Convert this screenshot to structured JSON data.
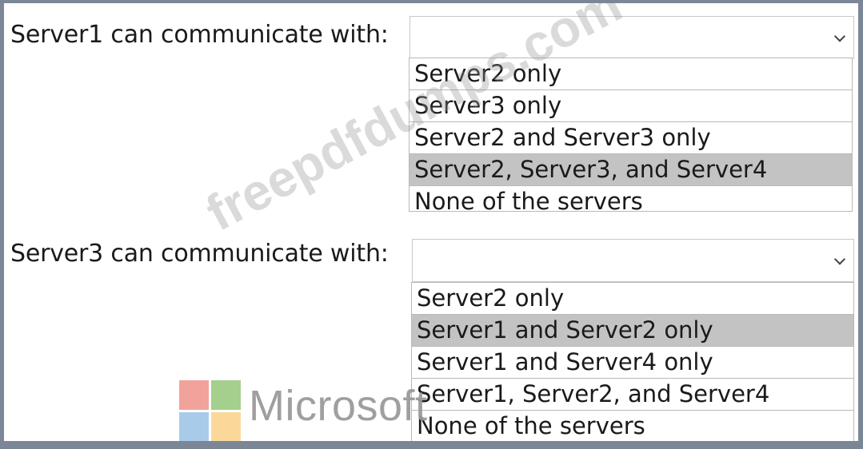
{
  "questions": [
    {
      "label": "Server1 can communicate with:",
      "selected_value": "",
      "options": [
        "Server2 only",
        "Server3 only",
        "Server2 and Server3 only",
        "Server2, Server3, and Server4",
        "None of the servers"
      ],
      "highlighted_index": 3
    },
    {
      "label": "Server3 can communicate with:",
      "selected_value": "",
      "options": [
        "Server2 only",
        "Server1 and Server2 only",
        "Server1 and Server4 only",
        "Server1, Server2, and Server4",
        "None of the servers"
      ],
      "highlighted_index": 1
    }
  ],
  "watermark": {
    "text": "freepdfdumps.com"
  },
  "logo": {
    "text": "Microsoft",
    "colors": {
      "red": "#f1a39b",
      "green": "#a4cf8d",
      "blue": "#a8cbe9",
      "yellow": "#fbd89a"
    }
  },
  "colors": {
    "border": "#7b8796",
    "highlight": "#c3c3c3"
  }
}
